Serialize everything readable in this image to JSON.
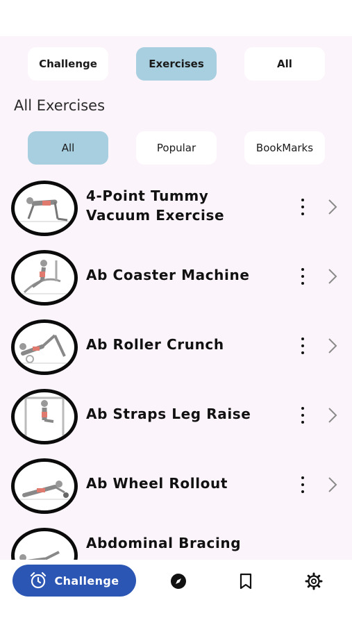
{
  "top_tabs": [
    {
      "label": "Challenge",
      "active": false
    },
    {
      "label": "Exercises",
      "active": true
    },
    {
      "label": "All",
      "active": false
    }
  ],
  "section_title": "All Exercises",
  "filters": [
    {
      "label": "All",
      "active": true
    },
    {
      "label": "Popular",
      "active": false
    },
    {
      "label": "BookMarks",
      "active": false
    }
  ],
  "exercises": [
    {
      "line1": "4-Point Tummy",
      "line2": "Vacuum Exercise",
      "thumb_icon": "kneeling-figure-icon"
    },
    {
      "line1": "Ab Coaster Machine",
      "line2": "",
      "thumb_icon": "machine-figure-icon"
    },
    {
      "line1": "Ab Roller Crunch",
      "line2": "",
      "thumb_icon": "crunch-figure-icon"
    },
    {
      "line1": "Ab Straps Leg Raise",
      "line2": "",
      "thumb_icon": "hanging-figure-icon"
    },
    {
      "line1": "Ab Wheel Rollout",
      "line2": "",
      "thumb_icon": "rollout-figure-icon"
    },
    {
      "line1": "Abdominal Bracing",
      "line2": "",
      "thumb_icon": "bracing-figure-icon"
    }
  ],
  "bottom_nav": {
    "primary_label": "Challenge",
    "items": [
      "alarm-clock-icon",
      "compass-icon",
      "bookmark-icon",
      "settings-gear-icon"
    ]
  },
  "colors": {
    "active_chip": "#a7cfe0",
    "primary_button": "#2b56b4",
    "list_background": "#fcf4fb",
    "accent_muscle": "#e07a6e"
  }
}
